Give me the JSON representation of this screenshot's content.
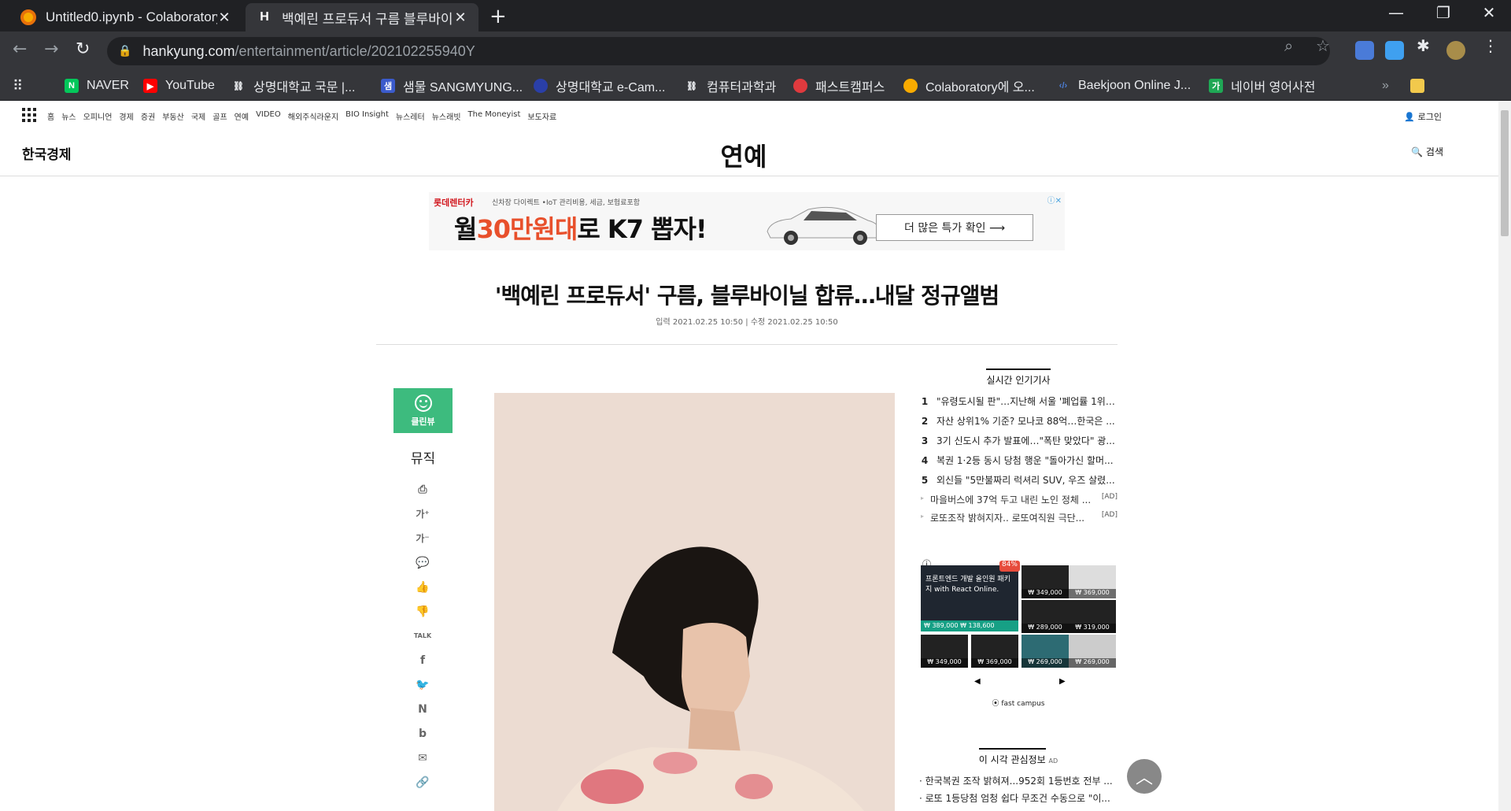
{
  "browser": {
    "tabs": [
      {
        "title": "Untitled0.ipynb - Colaboratory",
        "active": false
      },
      {
        "title": "백예린 프로듀서 구름 블루바이닐",
        "active": true
      }
    ],
    "url": {
      "host": "hankyung.com",
      "path": "/entertainment/article/202102255940Y"
    },
    "bookmarks": [
      {
        "label": "NAVER",
        "icon": "naver-icon",
        "color": "#03c75a"
      },
      {
        "label": "YouTube",
        "icon": "youtube-icon",
        "color": "#ff0000"
      },
      {
        "label": "상명대학교 국문 |...",
        "icon": "sangmyung-icon",
        "color": "#ffffff"
      },
      {
        "label": "샘물 SANGMYUNG...",
        "icon": "sangmyung-blue-icon",
        "color": "#3b5bcc"
      },
      {
        "label": "상명대학교 e-Cam...",
        "icon": "ecampus-icon",
        "color": "#2a3fa8"
      },
      {
        "label": "컴퓨터과학과",
        "icon": "cs-icon",
        "color": "#ffffff"
      },
      {
        "label": "패스트캠퍼스",
        "icon": "fastcampus-icon",
        "color": "#e03a3e"
      },
      {
        "label": "Colaboratory에 오...",
        "icon": "colab-icon",
        "color": "#f9ab00"
      },
      {
        "label": "Baekjoon Online J...",
        "icon": "baekjoon-icon",
        "color": "#4c7fd8"
      },
      {
        "label": "네이버 영어사전",
        "icon": "naver-dict-icon",
        "color": "#1fa855"
      }
    ]
  },
  "site": {
    "gnb": [
      "홈",
      "뉴스",
      "오피니언",
      "경제",
      "증권",
      "부동산",
      "국제",
      "골프",
      "연예",
      "VIDEO",
      "해외주식라운지",
      "BIO Insight",
      "뉴스레터",
      "뉴스래빗",
      "The Moneyist",
      "보도자료"
    ],
    "login": "로그인",
    "logo": "한국경제",
    "section": "연예",
    "search": "검색"
  },
  "ad": {
    "brand": "롯데렌터카",
    "small": "신차장 다이렉트 •IoT 관리비용, 세금, 보험료포함",
    "big_prefix": "월",
    "big_red": "30만원대",
    "big_suffix": "로 K7 뽑자!",
    "cta": "더 많은 특가 확인  ⟶"
  },
  "article": {
    "headline": "'백예린 프로듀서' 구름, 블루바이닐 합류…내달 정규앨범",
    "dates": "입력 2021.02.25 10:50 | 수정 2021.02.25 10:50",
    "cleanview": "클린뷰",
    "category": "뮤직",
    "share_icons": [
      "print-icon",
      "font-up-icon",
      "font-down-icon",
      "comment-icon",
      "like-icon",
      "dislike-icon",
      "talk-icon",
      "facebook-icon",
      "twitter-icon",
      "naver-blog-icon",
      "band-icon",
      "mail-icon",
      "link-icon"
    ]
  },
  "popular": {
    "title": "실시간 인기기사",
    "items": [
      {
        "rank": "1",
        "text": "\"유령도시될 판\"…지난해 서울 '폐업률 1위' ..."
      },
      {
        "rank": "2",
        "text": "자산 상위1% 기준? 모나코 88억…한국은 ..."
      },
      {
        "rank": "3",
        "text": "3기 신도시 추가 발표에…\"폭탄 맞았다\" 광..."
      },
      {
        "rank": "4",
        "text": "복권 1·2등 동시 당첨 행운 \"돌아가신 할머..."
      },
      {
        "rank": "5",
        "text": "외신들 \"5만불짜리 럭셔리 SUV, 우즈 살렸..."
      }
    ],
    "ads": [
      {
        "text": "마을버스에 37억 두고 내린 노인 정체 ...",
        "tag": "[AD]"
      },
      {
        "text": "로또조작 밝혀지자.. 로또여직원 극단...",
        "tag": "[AD]"
      }
    ]
  },
  "fastcampus": {
    "badge": "84%",
    "big_title": "프론트엔드 개발 올인원 패키지 with React Online.",
    "big_price": "₩ 389,000 ₩ 138,600",
    "thumbs": [
      "₩ 349,000",
      "₩ 369,000",
      "₩ 289,000",
      "₩ 319,000",
      "₩ 349,000",
      "₩ 369,000",
      "₩ 269,000",
      "₩ 269,000"
    ],
    "logo": "⦿ fast campus"
  },
  "interest": {
    "title": "이 시각 관심정보",
    "ad": "AD",
    "items": [
      "한국복권 조작 밝혀져...952회 1등번호 전부 ...",
      "로또 1등당첨 엄청 쉽다 무조건 수동으로 \"이..."
    ]
  }
}
